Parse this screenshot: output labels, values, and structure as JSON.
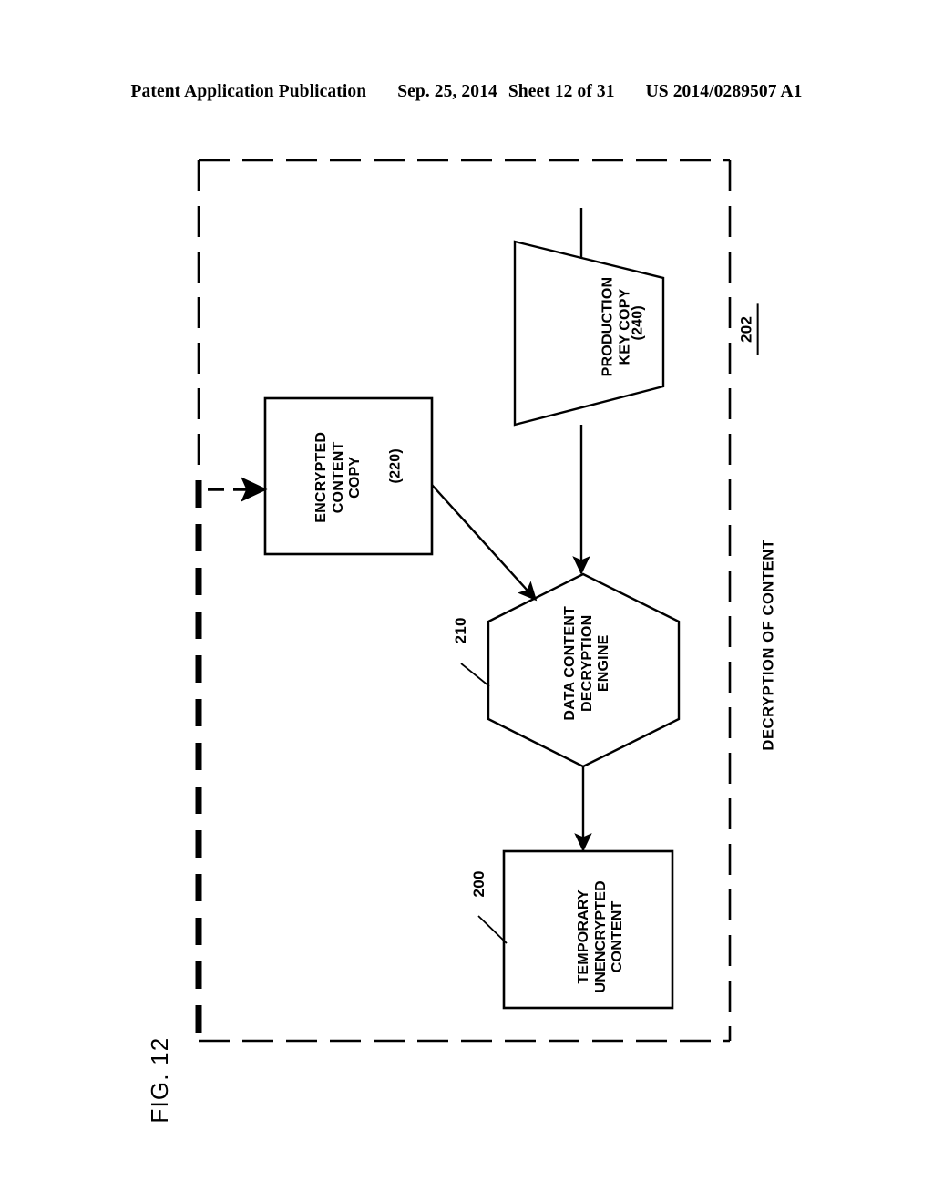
{
  "header": {
    "publication": "Patent Application Publication",
    "date": "Sep. 25, 2014",
    "sheet": "Sheet 12 of 31",
    "patent_number": "US 2014/0289507 A1"
  },
  "figure": {
    "number": "FIG. 12",
    "boundary": {
      "label": "DECRYPTION OF CONTENT",
      "reference": "202",
      "style": "dashed"
    },
    "nodes": [
      {
        "id": "production-key-copy",
        "shape": "trapezoid",
        "lines": [
          "PRODUCTION",
          "KEY COPY"
        ],
        "reference": "(240)"
      },
      {
        "id": "encrypted-content-copy",
        "shape": "rectangle",
        "lines": [
          "ENCRYPTED",
          "CONTENT",
          "COPY"
        ],
        "reference": "(220)"
      },
      {
        "id": "data-content-decryption-engine",
        "shape": "hexagon",
        "lines": [
          "DATA CONTENT",
          "DECRYPTION",
          "ENGINE"
        ],
        "reference": "210"
      },
      {
        "id": "temporary-unencrypted-content",
        "shape": "rectangle",
        "lines": [
          "TEMPORARY",
          "UNENCRYPTED",
          "CONTENT"
        ],
        "reference": "200"
      }
    ]
  }
}
